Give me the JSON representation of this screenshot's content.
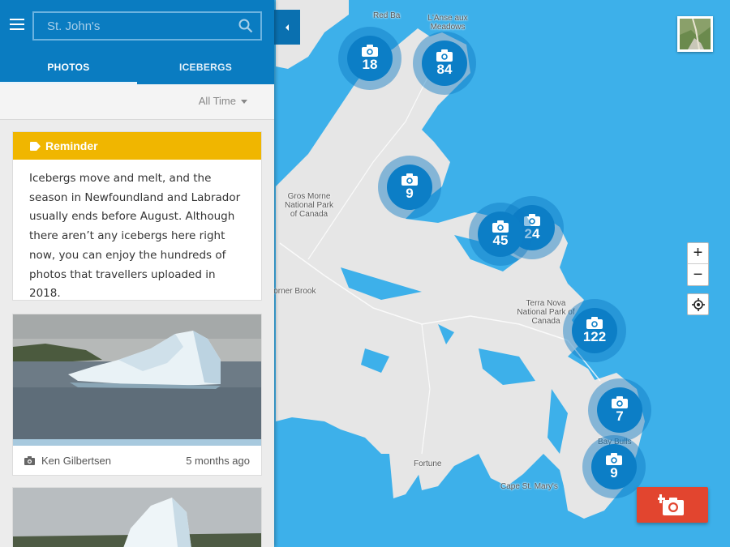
{
  "search": {
    "value": "",
    "placeholder": "St. John's"
  },
  "tabs": [
    {
      "label": "PHOTOS",
      "active": true
    },
    {
      "label": "ICEBERGS",
      "active": false
    }
  ],
  "filter": {
    "label": "All Time"
  },
  "reminder": {
    "title": "Reminder",
    "body": "Icebergs move and melt, and the season in Newfoundland and Labrador usually ends before August. Although there aren’t any icebergs here right now, you can enjoy the hundreds of photos that travellers uploaded in 2018."
  },
  "photos": [
    {
      "author": "Ken Gilbertsen",
      "time": "5 months ago"
    }
  ],
  "clusters": [
    {
      "count": "18"
    },
    {
      "count": "84"
    },
    {
      "count": "9"
    },
    {
      "count": "45"
    },
    {
      "count": "24"
    },
    {
      "count": "122"
    },
    {
      "count": "7"
    },
    {
      "count": "9"
    }
  ],
  "places": {
    "red_bay": "Red Ba",
    "lanse_aux_meadows": "L'Anse aux Meadows",
    "gros_morne": "Gros Morne National Park of Canada",
    "corner_brook": "Corner Brook",
    "terra_nova": "Terra Nova National Park of Canada",
    "bay_bulls": "Bay Bulls",
    "fortune": "Fortune",
    "cape_st_marys": "Cape St. Mary's"
  },
  "zoom": {
    "in": "+",
    "out": "−"
  },
  "colors": {
    "water": "#3db0ea",
    "land": "#e6e6e6",
    "header_blue": "#0a7cc1",
    "cluster_blue": "#0c7ec6",
    "reminder_yellow": "#f0b600",
    "add_button_red": "#e2452f"
  },
  "icons": {
    "menu": "menu-icon",
    "search": "search-icon",
    "collapse": "chevron-left-icon",
    "satellite": "satellite-layer-icon",
    "locate": "crosshair-icon",
    "add_photo": "add-camera-icon",
    "reminder": "tag-icon",
    "camera": "camera-icon"
  }
}
